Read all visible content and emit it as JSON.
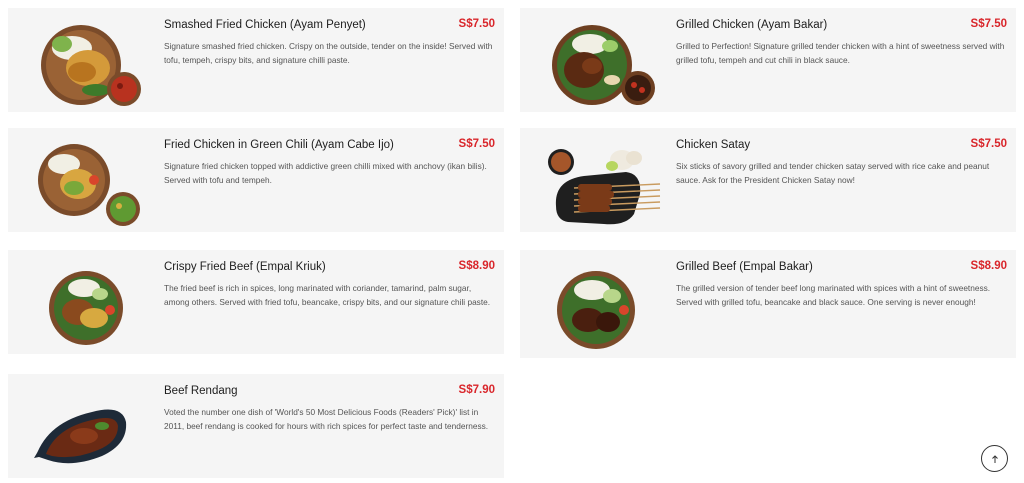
{
  "menu": {
    "items": [
      {
        "name": "Smashed Fried Chicken (Ayam Penyet)",
        "price": "S$7.50",
        "description": "Signature smashed fried chicken. Crispy on the outside, tender on the inside! Served with tofu, tempeh, crispy bits, and signature chilli paste.",
        "image_icon": "fried-chicken-plate-icon"
      },
      {
        "name": "Grilled Chicken (Ayam Bakar)",
        "price": "S$7.50",
        "description": "Grilled to Perfection! Signature grilled tender chicken with a hint of sweetness served with grilled tofu, tempeh and cut chili in black sauce.",
        "image_icon": "grilled-chicken-plate-icon"
      },
      {
        "name": "Fried Chicken in Green Chili (Ayam Cabe Ijo)",
        "price": "S$7.50",
        "description": "Signature fried chicken topped with addictive green chilli mixed with anchovy (ikan bilis). Served with tofu and tempeh.",
        "image_icon": "green-chili-chicken-plate-icon"
      },
      {
        "name": "Chicken Satay",
        "price": "S$7.50",
        "description": "Six sticks of savory grilled and tender chicken satay served with rice cake and peanut sauce. Ask for the President Chicken Satay now!",
        "image_icon": "satay-skewers-icon"
      },
      {
        "name": "Crispy Fried Beef (Empal Kriuk)",
        "price": "S$8.90",
        "description": "The fried beef is rich in spices, long marinated with coriander, tamarind, palm sugar, among others. Served with fried tofu, beancake, crispy bits, and our signature chili paste.",
        "image_icon": "crispy-beef-plate-icon"
      },
      {
        "name": "Grilled Beef (Empal Bakar)",
        "price": "S$8.90",
        "description": "The grilled version of tender beef long marinated with spices with a hint of sweetness. Served with grilled tofu, beancake and black sauce. One serving is never enough!",
        "image_icon": "grilled-beef-plate-icon"
      },
      {
        "name": "Beef Rendang",
        "price": "S$7.90",
        "description": "Voted the number one dish of 'World's 50 Most Delicious Foods (Readers' Pick)' list in 2011, beef rendang is cooked for hours with rich spices for perfect taste and tenderness.",
        "image_icon": "beef-rendang-dish-icon"
      }
    ]
  },
  "colors": {
    "price": "#d9262b",
    "card_bg": "#f5f5f5",
    "title": "#1d1d1d",
    "text": "#555555"
  },
  "scroll_top_icon": "arrow-up-icon"
}
